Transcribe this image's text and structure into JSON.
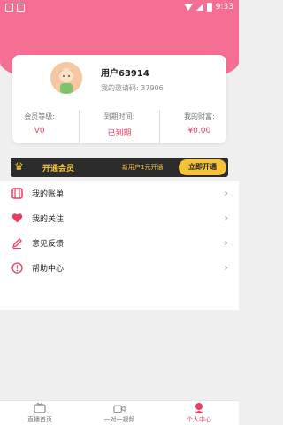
{
  "statusbar": {
    "time": "9:33"
  },
  "profile": {
    "username": "用户63914",
    "invite_label": "我的邀请码: 37906"
  },
  "stats": [
    {
      "label": "会员等级:",
      "value": "V0"
    },
    {
      "label": "到期时间:",
      "value": "已到期"
    },
    {
      "label": "我的财富:",
      "value": "¥0.00"
    }
  ],
  "vip": {
    "title": "开通会员",
    "note": "新用户1元开通",
    "button": "立即开通"
  },
  "menu": [
    {
      "label": "我的账单",
      "icon": "bill-icon"
    },
    {
      "label": "我的关注",
      "icon": "heart-icon"
    },
    {
      "label": "意见反馈",
      "icon": "pencil-icon"
    },
    {
      "label": "帮助中心",
      "icon": "info-icon"
    }
  ],
  "tabs": [
    {
      "label": "直播首页",
      "icon": "tv-icon"
    },
    {
      "label": "一对一视频",
      "icon": "video-icon"
    },
    {
      "label": "个人中心",
      "icon": "profile-icon"
    }
  ],
  "colors": {
    "accent": "#ef3b5f",
    "header": "#f56f93",
    "vip_gold": "#f6c23a"
  }
}
